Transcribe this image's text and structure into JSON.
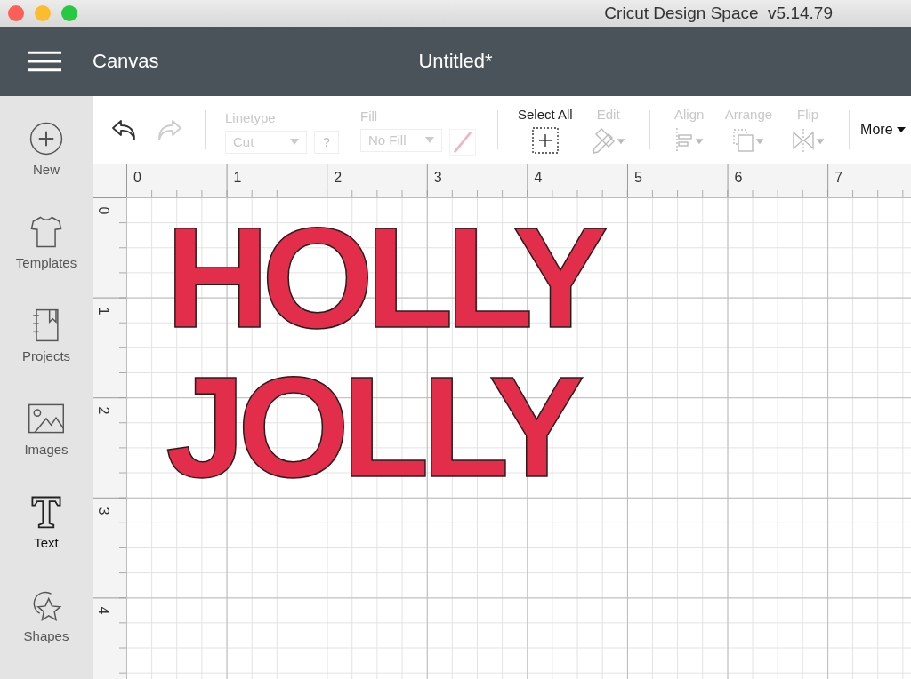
{
  "window": {
    "title": "Cricut Design Space  v5.14.79"
  },
  "header": {
    "section": "Canvas",
    "document": "Untitled*"
  },
  "sidebar": {
    "items": [
      {
        "label": "New",
        "kind": "new",
        "selected": false
      },
      {
        "label": "Templates",
        "kind": "templates",
        "selected": false
      },
      {
        "label": "Projects",
        "kind": "projects",
        "selected": false
      },
      {
        "label": "Images",
        "kind": "images",
        "selected": false
      },
      {
        "label": "Text",
        "kind": "text",
        "selected": true
      },
      {
        "label": "Shapes",
        "kind": "shapes",
        "selected": false
      }
    ]
  },
  "toolbar": {
    "undo": {
      "disabled": false
    },
    "redo": {
      "disabled": true
    },
    "linetype": {
      "label": "Linetype",
      "value": "Cut",
      "help": "?",
      "disabled": true
    },
    "fill": {
      "label": "Fill",
      "value": "No Fill",
      "disabled": true
    },
    "action_groups": [
      [
        {
          "label": "Select All",
          "kind": "select-all",
          "disabled": false
        },
        {
          "label": "Edit",
          "kind": "edit",
          "disabled": true
        }
      ],
      [
        {
          "label": "Align",
          "kind": "align",
          "disabled": true
        },
        {
          "label": "Arrange",
          "kind": "arrange",
          "disabled": true
        },
        {
          "label": "Flip",
          "kind": "flip",
          "disabled": true
        }
      ]
    ],
    "more": "More"
  },
  "rulers": {
    "horizontal": [
      "0",
      "1",
      "2",
      "3",
      "4",
      "5",
      "6",
      "7"
    ],
    "vertical": [
      "0",
      "1",
      "2",
      "3",
      "4"
    ]
  },
  "canvas": {
    "lines": [
      "HOLLY",
      "JOLLY"
    ]
  }
}
